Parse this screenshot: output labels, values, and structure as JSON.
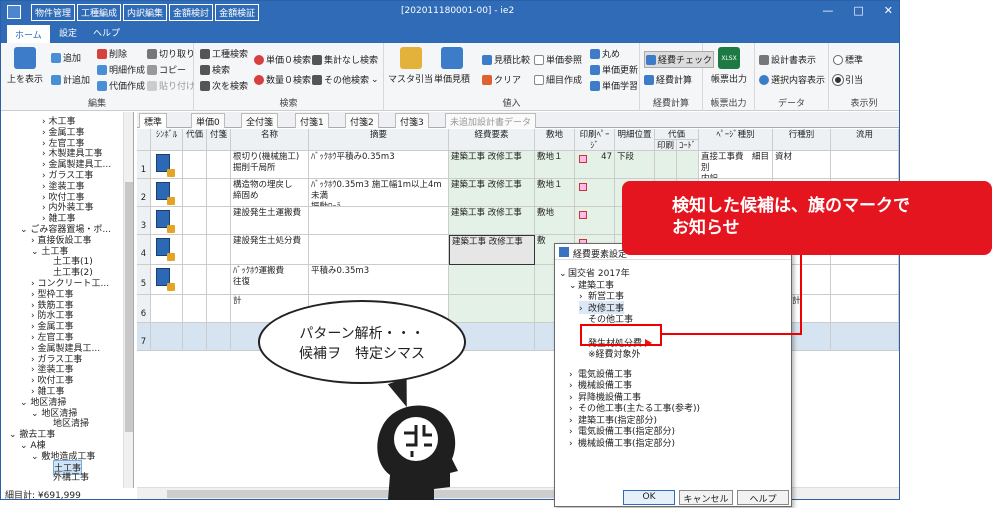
{
  "window": {
    "title": "[202011180001-00] - ie2",
    "menu": [
      "物件管理",
      "工種編成",
      "内訳編集",
      "金額検討",
      "金額検証"
    ],
    "controls": [
      "—",
      "□",
      "✕"
    ]
  },
  "ribbon_tabs": {
    "home": "ホーム",
    "settings": "設定",
    "help": "ヘルプ"
  },
  "ribbon": {
    "edit": {
      "label": "編集",
      "show_above": "上を表示",
      "add": "追加",
      "subtotal_add": "計追加",
      "delete": "削除",
      "detail_create": "明細作成",
      "replace_create": "代価作成",
      "cut": "切り取り",
      "copy": "コピー",
      "paste": "貼り付け"
    },
    "search": {
      "label": "検索",
      "work_search": "工種検索",
      "search": "検索",
      "next_search": "次を検索",
      "unit_zero": "単価０検索",
      "qty_zero": "数量０検索",
      "no_total": "集計なし検索",
      "other": "その他検索"
    },
    "pull": {
      "label": "値入",
      "master_pull": "マスタ引当",
      "unit_quote": "単価見積",
      "quote_compare": "見積比較",
      "clear": "クリア",
      "unit_ref": "単価参照",
      "detail_create": "細目作成",
      "round": "丸め",
      "unit_update": "単価更新",
      "unit_learn": "単価学習"
    },
    "cost": {
      "label": "経費計算",
      "cost_check": "経費チェック",
      "cost_calc": "経費計算"
    },
    "form": {
      "label": "帳票出力",
      "form_out": "帳票出力",
      "xlsx": "XLSX"
    },
    "data": {
      "label": "データ",
      "design_show": "設計書表示",
      "selected_show": "選択内容表示"
    },
    "display": {
      "label": "表示列",
      "standard": "標準",
      "pull": "引当"
    }
  },
  "sidebar": {
    "items": [
      {
        "label": "木工事",
        "indent": 3
      },
      {
        "label": "金属工事",
        "indent": 3
      },
      {
        "label": "左官工事",
        "indent": 3
      },
      {
        "label": "木製建具工事",
        "indent": 3
      },
      {
        "label": "金属製建具工...",
        "indent": 3
      },
      {
        "label": "ガラス工事",
        "indent": 3
      },
      {
        "label": "塗装工事",
        "indent": 3
      },
      {
        "label": "吹付工事",
        "indent": 3
      },
      {
        "label": "内外装工事",
        "indent": 3
      },
      {
        "label": "雑工事",
        "indent": 3
      },
      {
        "label": "ごみ容器置場・ポ...",
        "indent": 1
      },
      {
        "label": "直接仮設工事",
        "indent": 2
      },
      {
        "label": "土工事",
        "indent": 2
      },
      {
        "label": "土工事(1)",
        "indent": 4
      },
      {
        "label": "土工事(2)",
        "indent": 4
      },
      {
        "label": "コンクリート工...",
        "indent": 2
      },
      {
        "label": "型枠工事",
        "indent": 2
      },
      {
        "label": "鉄筋工事",
        "indent": 2
      },
      {
        "label": "防水工事",
        "indent": 2
      },
      {
        "label": "金属工事",
        "indent": 2
      },
      {
        "label": "左官工事",
        "indent": 2
      },
      {
        "label": "金属製建具工...",
        "indent": 2
      },
      {
        "label": "ガラス工事",
        "indent": 2
      },
      {
        "label": "塗装工事",
        "indent": 2
      },
      {
        "label": "吹付工事",
        "indent": 2
      },
      {
        "label": "雑工事",
        "indent": 2
      },
      {
        "label": "地区清掃",
        "indent": 1
      },
      {
        "label": "地区清掃",
        "indent": 2
      },
      {
        "label": "地区清掃",
        "indent": 4
      },
      {
        "label": "撤去工事",
        "indent": 0
      },
      {
        "label": "A棟",
        "indent": 1
      },
      {
        "label": "敷地造成工事",
        "indent": 2
      },
      {
        "label": "土工事",
        "indent": 4
      },
      {
        "label": "外構工事",
        "indent": 4
      }
    ],
    "status": "細目計: ¥691,999"
  },
  "grid_tabs": [
    "標準",
    "単価0",
    "全付箋",
    "付箋1",
    "付箋2",
    "付箋3",
    "未追加設計書データ"
  ],
  "grid": {
    "headers": {
      "symbol": "ｼﾝﾎﾞﾙ",
      "daika": "代価",
      "fusen": "付箋",
      "name": "名称",
      "summary": "摘要",
      "cost_element": "経費要素",
      "site": "敷地",
      "print_page": "印刷ﾍﾟｰｼﾞ",
      "detail_pos": "明細位置",
      "daika_group": "代価",
      "print": "印刷",
      "code": "ｺｰﾄﾞ",
      "page_type": "ﾍﾟｰｼﾞ種別",
      "row_type": "行種別",
      "flow": "流用"
    },
    "rows": [
      {
        "no": "1",
        "name": "根切り(機械施工)\n掘削千局所",
        "summary": "ﾊﾞｯｸﾎｳ平積み0.35m3",
        "cost": "建築工事 改修工事",
        "site": "敷地１",
        "page": "47",
        "pos": "下段",
        "ptype": "直接工事費　細目別\n内訳",
        "rtype": "資材"
      },
      {
        "no": "2",
        "name": "構造物の埋戻し\n締固め",
        "summary": "ﾊﾞｯｸﾎｳ0.35m3 施工幅1m以上4m未満\n振動ﾛｰﾗ",
        "cost": "建築工事 改修工事",
        "site": "敷地１",
        "page": "",
        "pos": "",
        "ptype": "",
        "rtype": ""
      },
      {
        "no": "3",
        "name": "建設発生土運搬費",
        "summary": "",
        "cost": "建築工事 改修工事",
        "site": "敷地",
        "page": "",
        "pos": "",
        "ptype": "",
        "rtype": ""
      },
      {
        "no": "4",
        "name": "建設発生土処分費",
        "summary": "",
        "cost": "建築工事 改修工事",
        "site": "敷",
        "page": "",
        "pos": "",
        "ptype": "",
        "rtype": ""
      },
      {
        "no": "5",
        "name": "ﾊﾞｯｸﾎｳ運搬費\n往復",
        "summary": "平積み0.35m3",
        "cost": "",
        "site": "",
        "page": "",
        "pos": "",
        "ptype": "",
        "rtype": "資材"
      },
      {
        "no": "6",
        "name": "計",
        "summary": "",
        "cost": "",
        "site": "",
        "page": "",
        "pos": "",
        "ptype": "",
        "rtype": "細目計"
      },
      {
        "no": "7",
        "name": "",
        "summary": "",
        "cost": "",
        "site": "",
        "page": "",
        "pos": "",
        "ptype": "",
        "rtype": ""
      }
    ]
  },
  "dialog": {
    "title": "経費要素設定",
    "items": [
      {
        "label": "国交省 2017年",
        "indent": 0,
        "exp": "⌄"
      },
      {
        "label": "建築工事",
        "indent": 1,
        "exp": "⌄"
      },
      {
        "label": "新営工事",
        "indent": 2,
        "exp": "›"
      },
      {
        "label": "改修工事",
        "indent": 2,
        "exp": "›"
      },
      {
        "label": "その他工事",
        "indent": 2,
        "exp": ""
      },
      {
        "label": "発生材処分費",
        "indent": 2,
        "exp": ""
      },
      {
        "label": "※経費対象外",
        "indent": 2,
        "exp": ""
      },
      {
        "label": "電気設備工事",
        "indent": 1,
        "exp": "›"
      },
      {
        "label": "機械設備工事",
        "indent": 1,
        "exp": "›"
      },
      {
        "label": "昇降機設備工事",
        "indent": 1,
        "exp": "›"
      },
      {
        "label": "その他工事(主たる工事(参考))",
        "indent": 1,
        "exp": "›"
      },
      {
        "label": "建築工事(指定部分)",
        "indent": 1,
        "exp": "›"
      },
      {
        "label": "電気設備工事(指定部分)",
        "indent": 1,
        "exp": "›"
      },
      {
        "label": "機械設備工事(指定部分)",
        "indent": 1,
        "exp": "›"
      }
    ],
    "ok": "OK",
    "cancel": "キャンセル",
    "help": "ヘルプ"
  },
  "overlay": {
    "callout": "検知した候補は、旗のマークで\nお知らせ",
    "thought": "パターン解析・・・\n候補ヲ　特定シマス"
  }
}
